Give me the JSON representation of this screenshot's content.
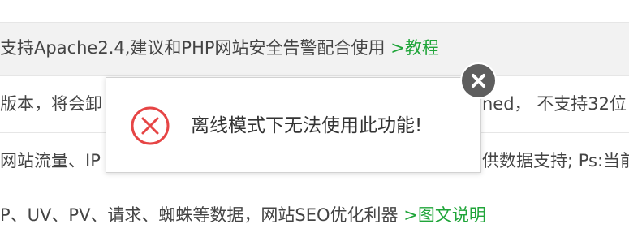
{
  "rows": [
    {
      "text": "支持Apache2.4,建议和PHP网站安全告警配合使用",
      "link": ">教程"
    },
    {
      "left": "版本，将会卸",
      "right": "ned， 不支持32位"
    },
    {
      "left": "网站流量、IP",
      "right": "供数据支持; Ps:当前"
    },
    {
      "text": "P、UV、PV、请求、蜘蛛等数据，网站SEO优化利器",
      "link": ">图文说明"
    }
  ],
  "dialog": {
    "icon": "error-x-icon",
    "message": "离线模式下无法使用此功能!"
  },
  "close_button": {
    "icon": "close-icon"
  },
  "colors": {
    "accent_link": "#20a53a",
    "error_red": "#e64545",
    "close_bg": "#5e5e5e",
    "row_highlight": "#f2f2f2"
  }
}
